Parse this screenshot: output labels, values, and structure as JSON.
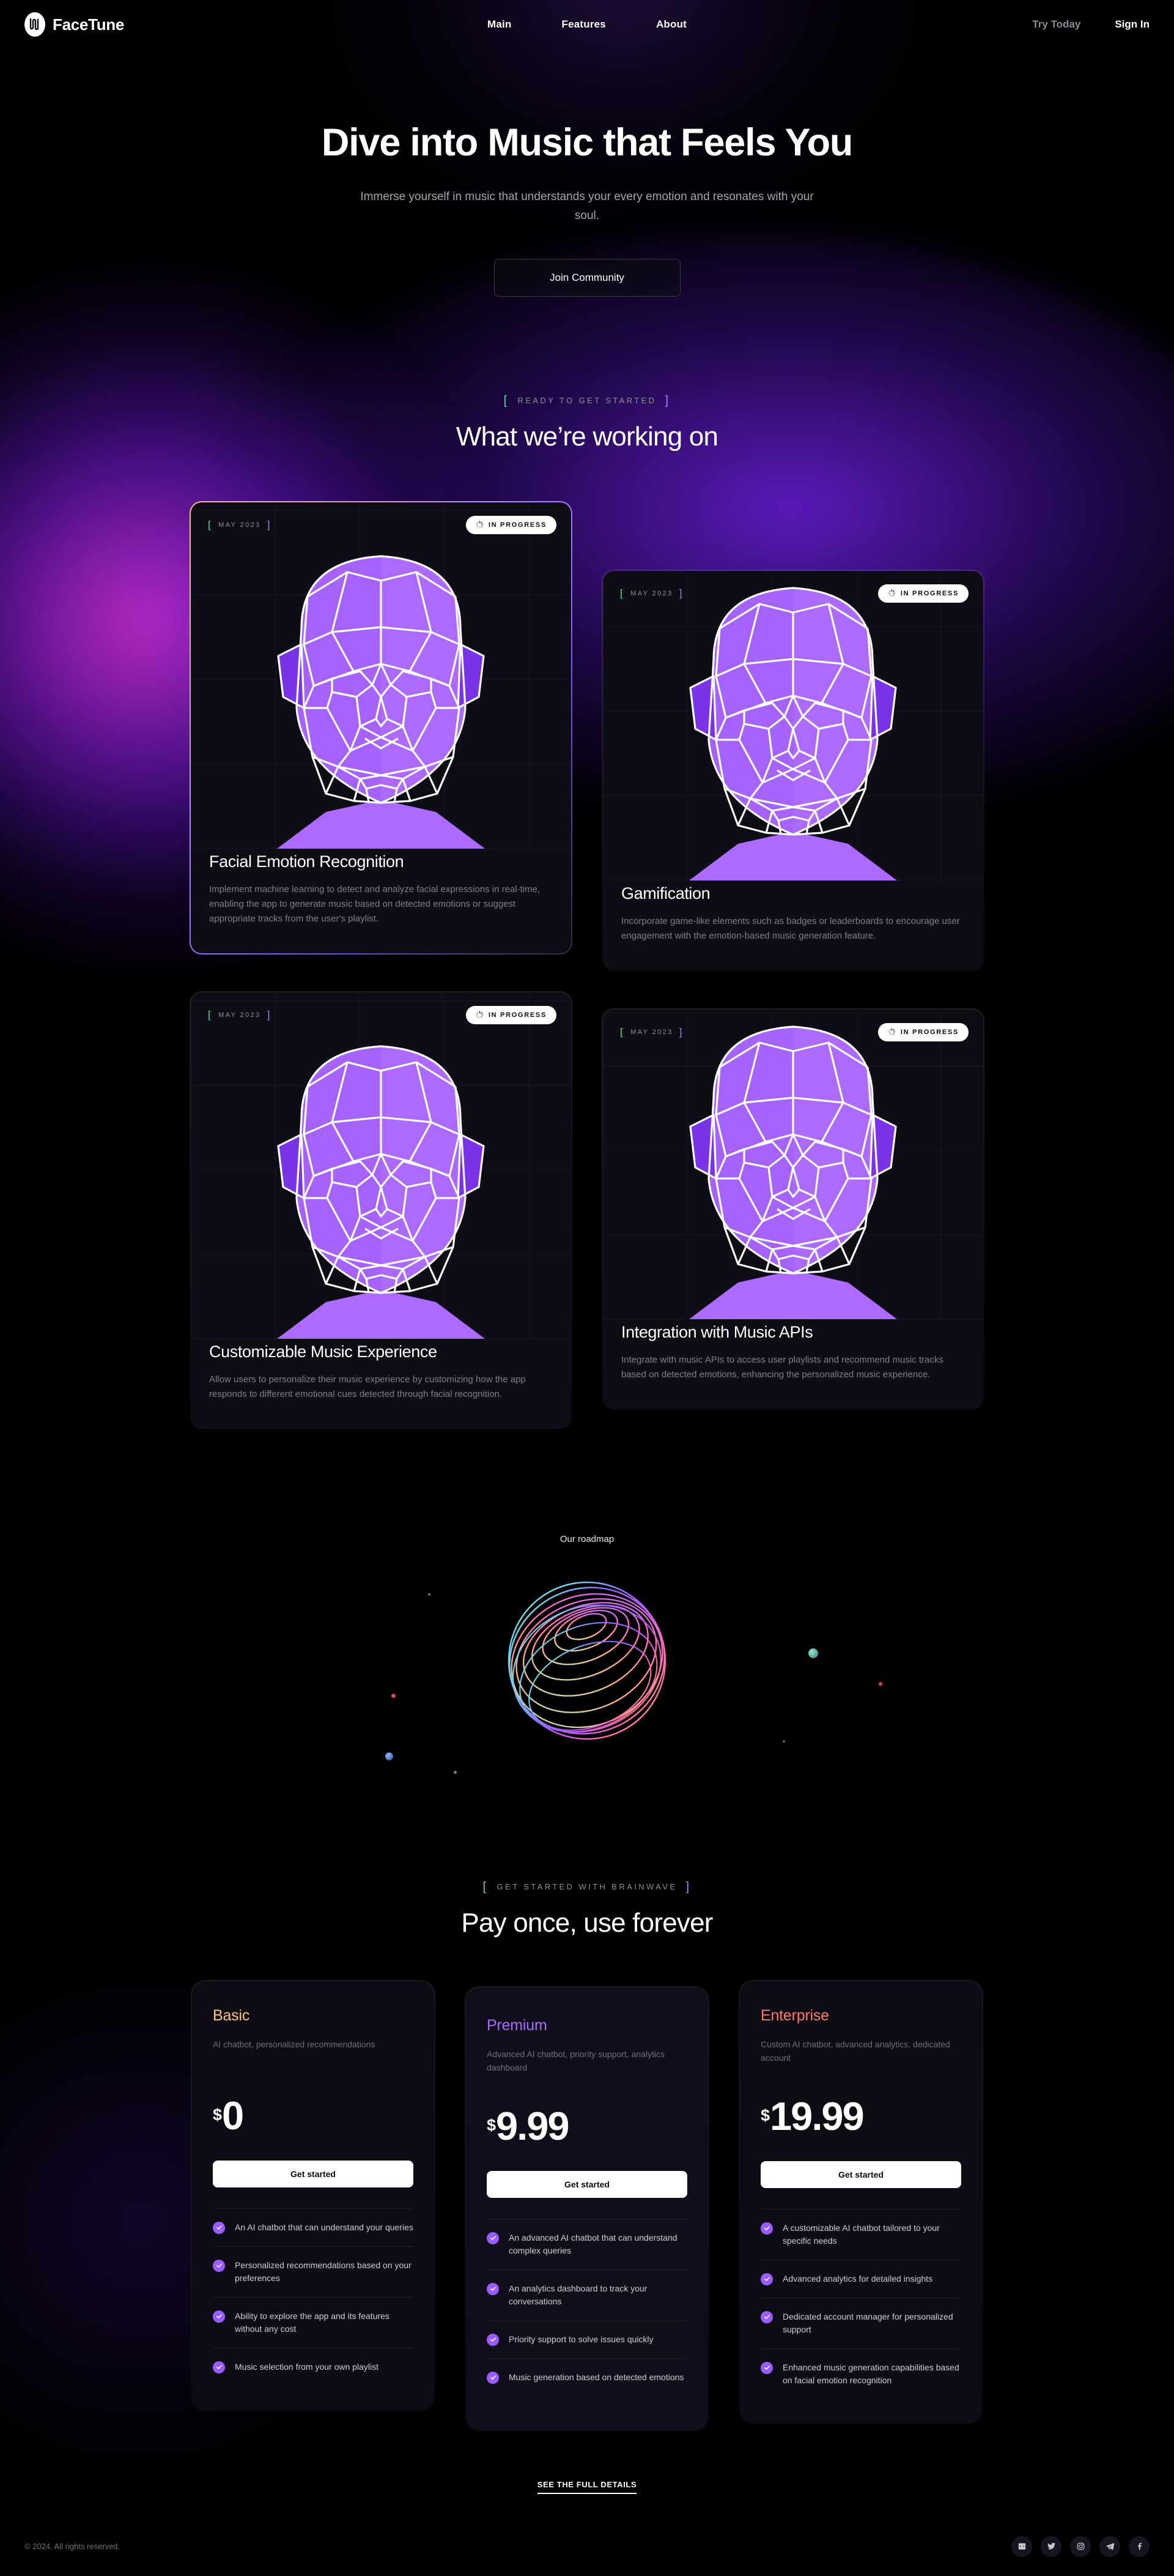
{
  "brand": {
    "name": "FaceTune",
    "logo_icon": "soundwave-logo-icon"
  },
  "nav": {
    "items": [
      {
        "label": "Main",
        "name": "nav-item-main"
      },
      {
        "label": "Features",
        "name": "nav-item-features"
      },
      {
        "label": "About",
        "name": "nav-item-about"
      }
    ],
    "try_today": "Try Today",
    "sign_in": "Sign In"
  },
  "hero": {
    "title": "Dive into Music that Feels You",
    "subtitle": "Immerse yourself in music that understands your every emotion and resonates with your soul.",
    "cta": "Join Community"
  },
  "roadmap_section": {
    "eyebrow": "READY TO GET STARTED",
    "bracket_left": "[",
    "bracket_right": "]",
    "title": "What we’re working on",
    "cards": [
      {
        "date": "MAY 2023",
        "status": "IN PROGRESS",
        "status_icon": "spinner-icon",
        "title": "Facial Emotion Recognition",
        "description": "Implement machine learning to detect and analyze facial expressions in real-time, enabling the app to generate music based on detected emotions or suggest appropriate tracks from the user's playlist.",
        "image_icon": "low-poly-face-icon"
      },
      {
        "date": "MAY 2023",
        "status": "IN PROGRESS",
        "status_icon": "spinner-icon",
        "title": "Gamification",
        "description": "Incorporate game-like elements such as badges or leaderboards to encourage user engagement with the emotion-based music generation feature.",
        "image_icon": "low-poly-face-icon"
      },
      {
        "date": "MAY 2023",
        "status": "IN PROGRESS",
        "status_icon": "spinner-icon",
        "title": "Customizable Music Experience",
        "description": "Allow users to personalize their music experience by customizing how the app responds to different emotional cues detected through facial recognition.",
        "image_icon": "low-poly-face-icon"
      },
      {
        "date": "MAY 2023",
        "status": "IN PROGRESS",
        "status_icon": "spinner-icon",
        "title": "Integration with Music APIs",
        "description": "Integrate with music APIs to access user playlists and recommend music tracks based on detected emotions, enhancing the personalized music experience.",
        "image_icon": "low-poly-face-icon"
      }
    ]
  },
  "globe": {
    "label": "Our roadmap",
    "icon": "gradient-sphere-icon"
  },
  "pricing": {
    "eyebrow": "GET STARTED WITH BRAINWAVE",
    "bracket_left": "[",
    "bracket_right": "]",
    "title": "Pay once, use forever",
    "plans": [
      {
        "name": "Basic",
        "color": "#FFC876",
        "description": "AI chatbot, personalized recommendations",
        "currency": "$",
        "price": "0",
        "cta": "Get started",
        "features": [
          "An AI chatbot that can understand your queries",
          "Personalized recommendations based on your preferences",
          "Ability to explore the app and its features without any cost",
          "Music selection from your own playlist"
        ]
      },
      {
        "name": "Premium",
        "color": "#AC6AFF",
        "description": "Advanced AI chatbot, priority support, analytics dashboard",
        "currency": "$",
        "price": "9.99",
        "cta": "Get started",
        "features": [
          "An advanced AI chatbot that can understand complex queries",
          "An analytics dashboard to track your conversations",
          "Priority support to solve issues quickly",
          "Music generation based on detected emotions"
        ]
      },
      {
        "name": "Enterprise",
        "color": "#FF776F",
        "description": "Custom AI chatbot, advanced analytics, dedicated account",
        "currency": "$",
        "price": "19.99",
        "cta": "Get started",
        "features": [
          "A customizable AI chatbot tailored to your specific needs",
          "Advanced analytics for detailed insights",
          "Dedicated account manager for personalized support",
          "Enhanced music generation capabilities based on facial emotion recognition"
        ]
      }
    ]
  },
  "footer": {
    "details_link": "SEE THE FULL DETAILS",
    "copyright": "© 2024. All rights reserved.",
    "socials": [
      {
        "name": "discord-icon"
      },
      {
        "name": "twitter-icon"
      },
      {
        "name": "instagram-icon"
      },
      {
        "name": "telegram-icon"
      },
      {
        "name": "facebook-icon"
      }
    ]
  }
}
